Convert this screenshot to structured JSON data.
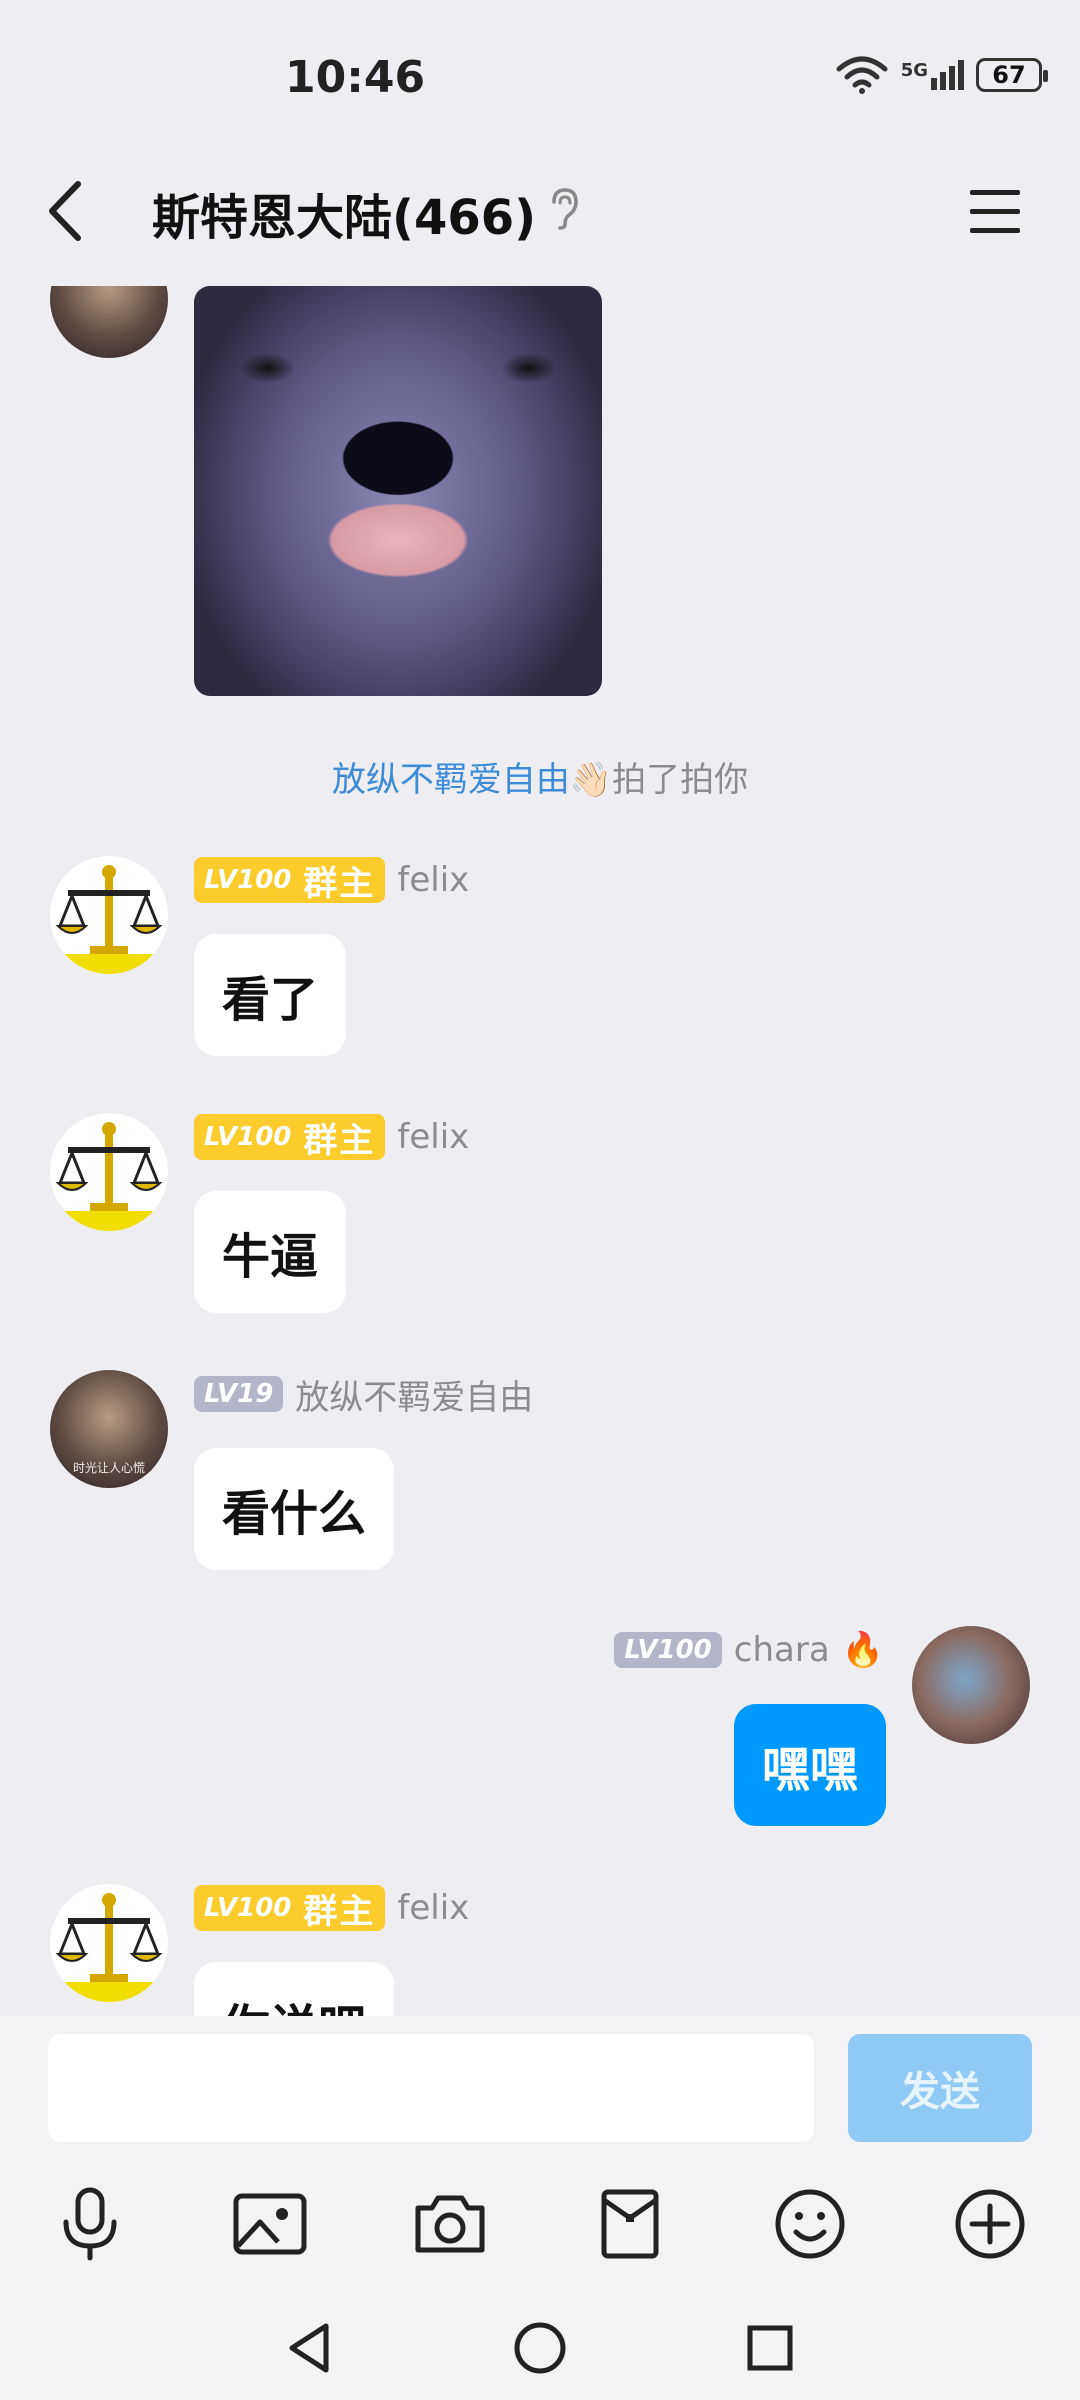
{
  "status_bar": {
    "time": "10:46",
    "network": "5G",
    "battery": "67"
  },
  "header": {
    "title": "斯特恩大陆(466)"
  },
  "messages": [
    {
      "avatar_caption": "时光让人心慌"
    },
    {
      "notice_name": "放纵不羁爱自由",
      "notice_emoji": "👋🏻",
      "notice_action": "拍了拍你"
    },
    {
      "level": "LV100",
      "role": "群主",
      "name": "felix",
      "text": "看了"
    },
    {
      "level": "LV100",
      "role": "群主",
      "name": "felix",
      "text": "牛逼"
    },
    {
      "level": "LV19",
      "name": "放纵不羁爱自由",
      "text": "看什么",
      "avatar_caption": "时光让人心慌"
    },
    {
      "level": "LV100",
      "name": "chara",
      "emoji": "🔥",
      "text": "嘿嘿"
    },
    {
      "level": "LV100",
      "role": "群主",
      "name": "felix",
      "text": "你说吧"
    }
  ],
  "input": {
    "placeholder": "",
    "send_label": "发送"
  },
  "toolbar_icons": [
    "microphone-icon",
    "image-icon",
    "camera-icon",
    "red-packet-icon",
    "emoji-icon",
    "plus-icon"
  ],
  "colors": {
    "accent": "#0099ff",
    "owner_badge": "#fccb2c",
    "level_badge": "#b3b6c9",
    "send_disabled": "#8fcaf7"
  }
}
